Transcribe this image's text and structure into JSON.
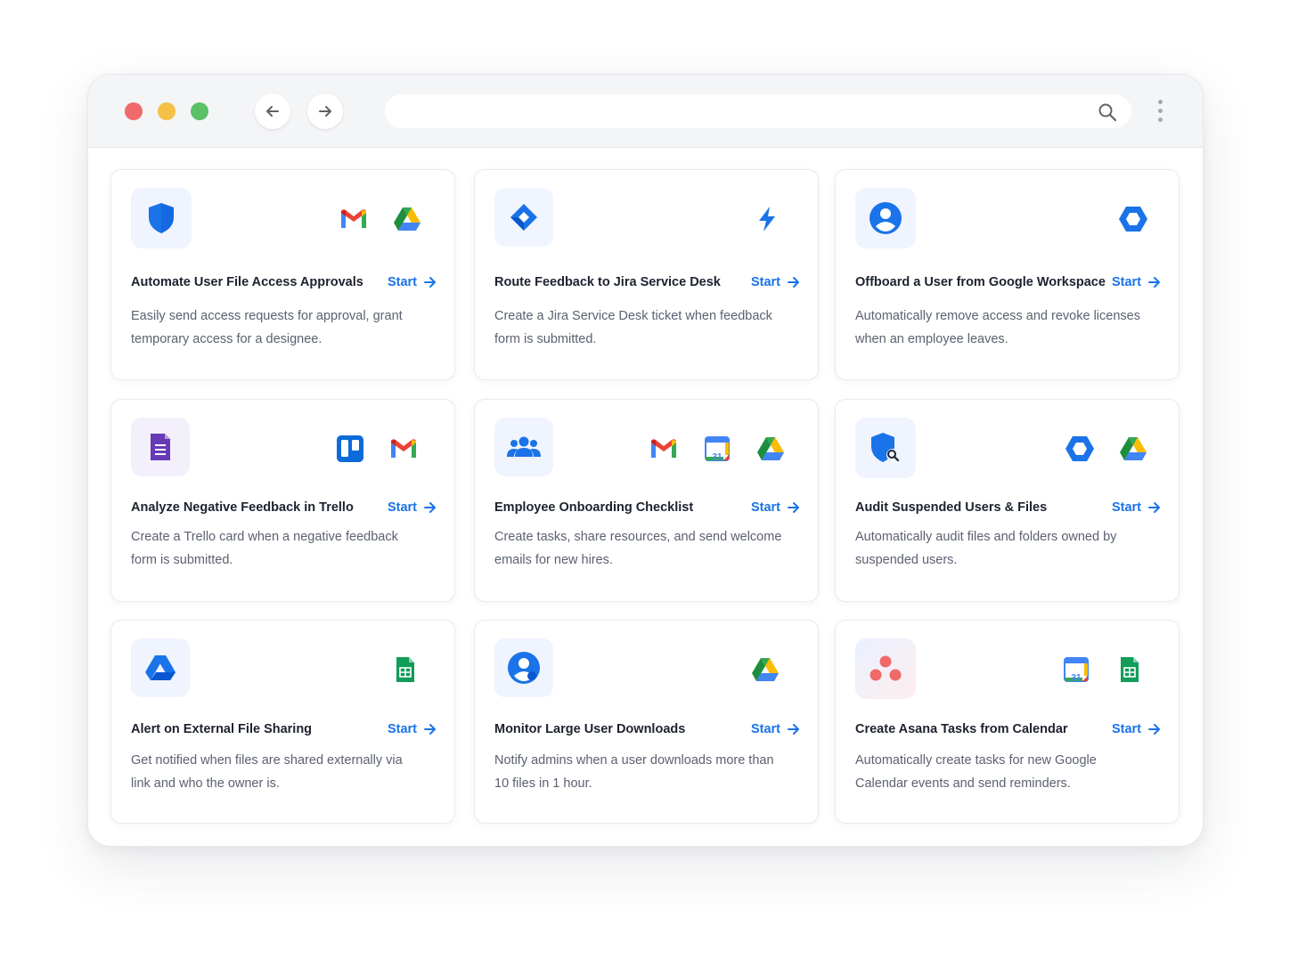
{
  "cards": [
    {
      "title": "Automate User File Access Approvals",
      "start": "Start",
      "desc": "Easily send access requests for approval, grant temporary access for a designee."
    },
    {
      "title": "Route Feedback to Jira Service Desk",
      "start": "Start",
      "desc": "Create a Jira Service Desk ticket when feedback form is submitted."
    },
    {
      "title": "Offboard a User from Google Workspace",
      "start": "Start",
      "desc": "Automatically remove access and revoke licenses when an employee leaves."
    },
    {
      "title": "Analyze Negative Feedback in Trello",
      "start": "Start",
      "desc": "Create a Trello card when a negative feedback form is submitted."
    },
    {
      "title": "Employee Onboarding Checklist",
      "start": "Start",
      "desc": "Create tasks, share resources, and send welcome emails for new hires."
    },
    {
      "title": "Audit Suspended Users & Files",
      "start": "Start",
      "desc": "Automatically audit files and folders owned by suspended users."
    },
    {
      "title": "Alert on External File Sharing",
      "start": "Start",
      "desc": "Get notified when files are shared externally via link and who the owner is."
    },
    {
      "title": "Monitor Large User Downloads",
      "start": "Start",
      "desc": "Notify admins when a user downloads more than 10 files in 1 hour."
    },
    {
      "title": "Create Asana Tasks from Calendar",
      "start": "Start",
      "desc": "Automatically create tasks for new Google Calendar events and send reminders."
    }
  ],
  "calendar_day": "31",
  "colors": {
    "accent": "#1a73e8",
    "title": "#1d2230",
    "body": "#5b6170"
  }
}
